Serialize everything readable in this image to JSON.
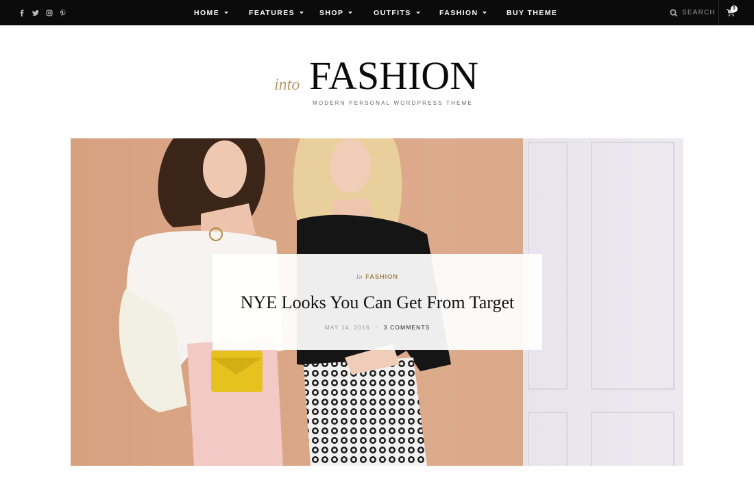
{
  "social": {
    "icons": [
      "facebook-icon",
      "twitter-icon",
      "instagram-icon",
      "pinterest-icon"
    ]
  },
  "nav": {
    "items": [
      {
        "label": "HOME",
        "has_dropdown": true
      },
      {
        "label": "FEATURES",
        "has_dropdown": true
      },
      {
        "label": "SHOP",
        "has_dropdown": true
      },
      {
        "label": "OUTFITS",
        "has_dropdown": true
      },
      {
        "label": "FASHION",
        "has_dropdown": true
      },
      {
        "label": "BUY THEME",
        "has_dropdown": false
      }
    ]
  },
  "header": {
    "search_label": "SEARCH",
    "cart_count": "0"
  },
  "logo": {
    "prefix": "into",
    "name": "FASHION",
    "tagline": "MODERN PERSONAL WORDPRESS THEME"
  },
  "featured": {
    "category_prefix": "In",
    "category": "FASHION",
    "title": "NYE Looks You Can Get From Target",
    "date": "MAY 14, 2016",
    "separator": "-",
    "comments": "3 COMMENTS"
  },
  "colors": {
    "topbar": "#0b0b0b",
    "accent_gold": "#b59b6a",
    "hero_backdrop": "#d9a785"
  }
}
